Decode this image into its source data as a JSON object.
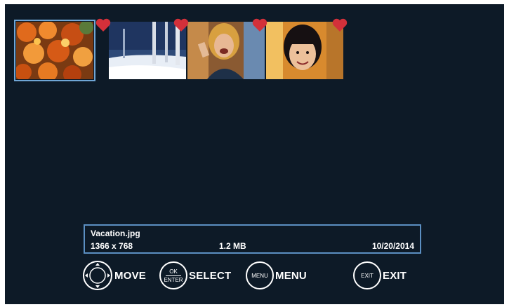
{
  "thumbnails": [
    {
      "name": "autumn-leaves",
      "favorite": true,
      "selected": true
    },
    {
      "name": "snowy-forest",
      "favorite": true,
      "selected": false
    },
    {
      "name": "laughing-woman",
      "favorite": true,
      "selected": false
    },
    {
      "name": "smiling-girl",
      "favorite": true,
      "selected": false
    }
  ],
  "info": {
    "filename": "Vacation.jpg",
    "resolution": "1366 x 768",
    "size": "1.2 MB",
    "date": "10/20/2014"
  },
  "controls": {
    "move_label": "MOVE",
    "select_label": "SELECT",
    "select_icon_top": "OK",
    "select_icon_bottom": "ENTER",
    "menu_label": "MENU",
    "menu_icon": "MENU",
    "exit_label": "EXIT",
    "exit_icon": "EXIT"
  },
  "colors": {
    "background": "#0d1a27",
    "selection_border": "#6fa6d6",
    "heart": "#d3303a",
    "info_border": "#5b8fc2",
    "text": "#ffffff"
  },
  "icons": {
    "favorite": "heart-icon",
    "move": "dpad-icon",
    "select": "ok-enter-icon",
    "menu": "menu-button-icon",
    "exit": "exit-button-icon"
  }
}
